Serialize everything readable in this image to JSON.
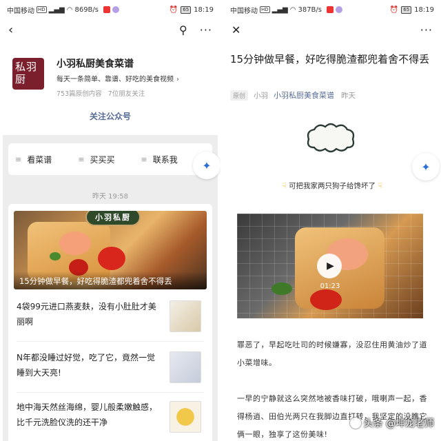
{
  "left": {
    "status": {
      "carrier": "中国移动",
      "hd": "HD",
      "speed": "869B/s",
      "battery": "65",
      "time": "18:19"
    },
    "account": {
      "logo_text": "私羽厨",
      "name": "小羽私厨美食菜谱",
      "description": "每天一条简单、靠谱、好吃的美食视频",
      "original_count": "753篇原创内容",
      "friends_follow": "7位朋友关注"
    },
    "follow_label": "关注公众号",
    "menu": [
      {
        "label": "看菜谱"
      },
      {
        "label": "买买买"
      },
      {
        "label": "联系我"
      }
    ],
    "timestamp": "昨天 19:58",
    "cover": {
      "badge": "小羽私厨",
      "caption": "15分钟做早餐，好吃得脆渣都兜着舍不得丢"
    },
    "articles": [
      {
        "title": "4袋99元进口燕麦麸，没有小肚肚才美丽啊"
      },
      {
        "title": "N年都没睡过好觉，吃了它，竟然一觉睡到大天亮!"
      },
      {
        "title": "地中海天然丝海绵，婴儿般柔嫩触感，比千元洗脸仪洗的还干净"
      }
    ]
  },
  "right": {
    "status": {
      "carrier": "中国移动",
      "hd": "HD",
      "speed": "387B/s",
      "battery": "65",
      "time": "18:19"
    },
    "title": "15分钟做早餐，好吃得脆渣都兜着舍不得丢",
    "meta": {
      "original": "原创",
      "author": "小羽",
      "account": "小羽私厨美食菜谱",
      "date": "昨天"
    },
    "notice": "可把我家两只狗子给馋坏了",
    "video_duration": "01:23",
    "paragraph1": "罪恶了，早起吃吐司的时候嫌寡，没忍住用黄油炒了道小菜增味。",
    "paragraph2": "一早的宁静就这么突然地被香味打破，哦喇声一起，香得杨逍、田伯光两只在我脚边直打转，我坚定的没瞧它俩一眼，独享了这份美味!"
  },
  "watermark": "头条 @坤龙老师"
}
